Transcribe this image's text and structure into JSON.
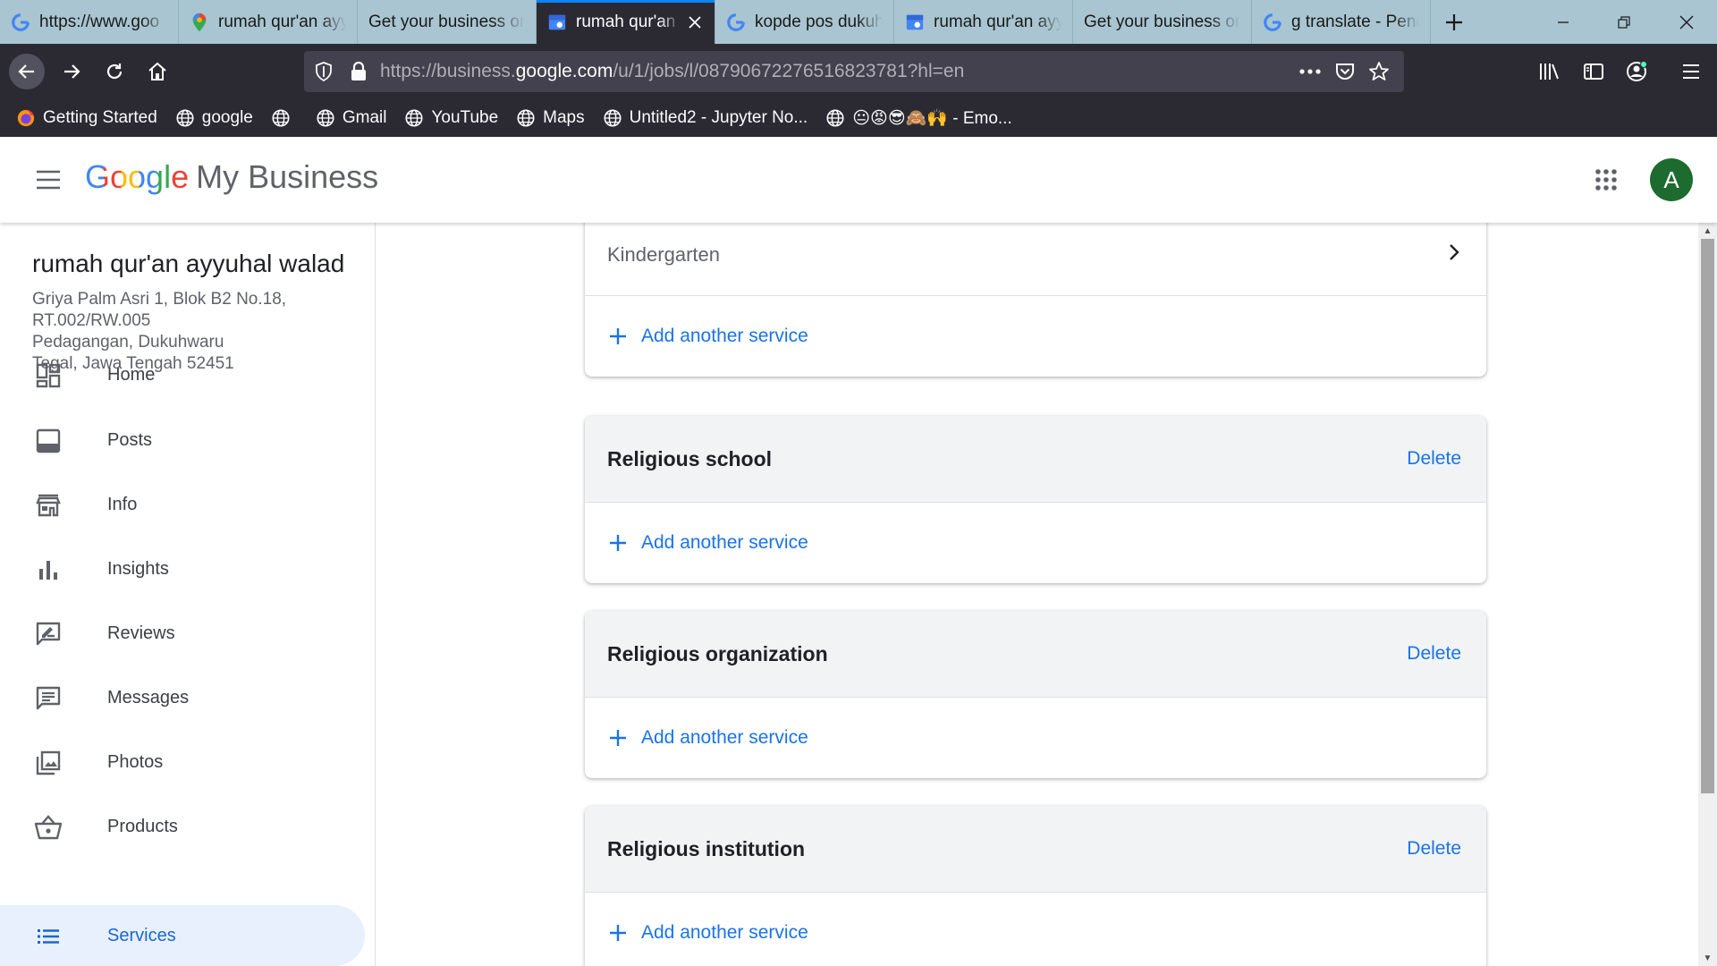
{
  "browser": {
    "tabs": [
      {
        "title": "https://www.goo",
        "favicon": "google-g-icon"
      },
      {
        "title": "rumah qur'an ayy",
        "favicon": "maps-pin-icon"
      },
      {
        "title": "Get your business on",
        "favicon": ""
      },
      {
        "title": "rumah qur'an",
        "favicon": "google-my-business-icon",
        "active": true
      },
      {
        "title": "kopde pos dukuh",
        "favicon": "google-g-icon"
      },
      {
        "title": "rumah qur'an ayy",
        "favicon": "google-my-business-icon"
      },
      {
        "title": "Get your business on",
        "favicon": ""
      },
      {
        "title": "g translate - Pene",
        "favicon": "google-g-icon"
      }
    ],
    "url_prefix": "https://business.",
    "url_host": "google.com",
    "url_rest": "/u/1/jobs/l/08790672276516823781?hl=en",
    "bookmarks": [
      {
        "label": "Getting Started",
        "icon": "firefox-icon"
      },
      {
        "label": "google",
        "icon": "globe-icon"
      },
      {
        "label": "",
        "icon": "globe-icon"
      },
      {
        "label": "Gmail",
        "icon": "globe-icon"
      },
      {
        "label": "YouTube",
        "icon": "globe-icon"
      },
      {
        "label": "Maps",
        "icon": "globe-icon"
      },
      {
        "label": "Untitled2 - Jupyter No...",
        "icon": "globe-icon"
      },
      {
        "label": "😐😡😎🙈🙌 - Emo...",
        "icon": "globe-icon"
      }
    ]
  },
  "app": {
    "logo_google": "Google",
    "logo_product": "My Business",
    "avatar_letter": "A"
  },
  "business": {
    "name": "rumah qur'an ayyuhal walad",
    "address_lines": [
      "Griya Palm Asri 1, Blok B2 No.18,",
      "RT.002/RW.005",
      "Pedagangan, Dukuhwaru",
      "Tegal, Jawa Tengah 52451"
    ]
  },
  "nav": [
    {
      "label": "Home",
      "icon": "dashboard-icon"
    },
    {
      "label": "Posts",
      "icon": "posts-icon"
    },
    {
      "label": "Info",
      "icon": "storefront-icon"
    },
    {
      "label": "Insights",
      "icon": "bar-chart-icon"
    },
    {
      "label": "Reviews",
      "icon": "rate-review-icon"
    },
    {
      "label": "Messages",
      "icon": "message-icon"
    },
    {
      "label": "Photos",
      "icon": "photo-library-icon"
    },
    {
      "label": "Products",
      "icon": "shopping-basket-icon"
    },
    {
      "label": "Services",
      "icon": "list-icon",
      "active": true
    }
  ],
  "services": {
    "partial_card": {
      "service_name": "Kindergarten",
      "add_label": "Add another service"
    },
    "categories": [
      {
        "name": "Religious school",
        "delete_label": "Delete",
        "add_label": "Add another service"
      },
      {
        "name": "Religious organization",
        "delete_label": "Delete",
        "add_label": "Add another service"
      },
      {
        "name": "Religious institution",
        "delete_label": "Delete",
        "add_label": "Add another service"
      }
    ]
  },
  "colors": {
    "accent": "#1a73e8",
    "active_nav_bg": "#e8f0fe",
    "avatar_bg": "#1e6b2f",
    "browser_chrome": "#2b2a33",
    "tabstrip": "#a9c5d1"
  }
}
